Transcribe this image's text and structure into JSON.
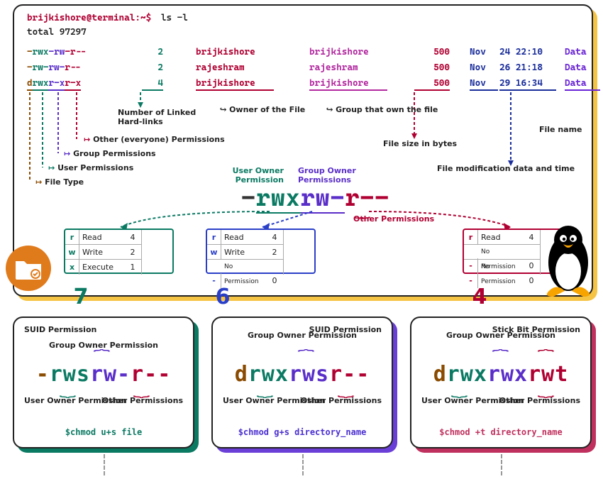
{
  "prompt": {
    "userhost": "brijkishore@terminal:~$",
    "cmd": "ls -l"
  },
  "total_line": "total 97297",
  "rows": [
    {
      "perm_d": "-",
      "perm_u": "rwx",
      "perm_g": "-rw",
      "perm_o": "-r--",
      "links": "2",
      "owner": "brijkishore",
      "group": "brijkishore",
      "size": "500",
      "month": "Nov",
      "daytime": "24 22:10",
      "name": "Data"
    },
    {
      "perm_d": "-",
      "perm_u": "rw-",
      "perm_g": "rw-",
      "perm_o": "r--",
      "links": "2",
      "owner": "rajeshram",
      "group": "rajeshram",
      "size": "500",
      "month": "Nov",
      "daytime": "26 21:18",
      "name": "Data"
    },
    {
      "perm_d": "d",
      "perm_u": "rwx",
      "perm_g": "r-x",
      "perm_o": "r-x",
      "links": "4",
      "owner": "brijkishore",
      "group": "brijkishore",
      "size": "500",
      "month": "Nov",
      "daytime": "29 16:34",
      "name": "Data"
    }
  ],
  "labels": {
    "hardlinks": "Number of Linked Hard-links",
    "owner": "Owner of the File",
    "group": "Group that own the file",
    "size": "File size in bytes",
    "mtime": "File modification data and time",
    "fname": "File name",
    "other_perm": "Other (everyone) Permissions",
    "group_perm": "Group Permissions",
    "user_perm": "User Permissions",
    "file_type": "File Type",
    "uo_perm": "User Owner Permission",
    "go_perm": "Group Owner Permissions",
    "oth_perm": "Other Permissions"
  },
  "bigperm": {
    "d": "-",
    "u": "rwx",
    "g": "rw-",
    "o": "r--"
  },
  "octal": {
    "green": {
      "rows": [
        {
          "s": "r",
          "n": "Read",
          "v": "4"
        },
        {
          "s": "w",
          "n": "Write",
          "v": "2"
        },
        {
          "s": "x",
          "n": "Execute",
          "v": "1"
        }
      ],
      "sum": "7"
    },
    "blue": {
      "rows": [
        {
          "s": "r",
          "n": "Read",
          "v": "4"
        },
        {
          "s": "w",
          "n": "Write",
          "v": "2"
        },
        {
          "s": "-",
          "n": "No Permission",
          "v": "0"
        }
      ],
      "sum": "6"
    },
    "red": {
      "rows": [
        {
          "s": "r",
          "n": "Read",
          "v": "4"
        },
        {
          "s": "-",
          "n": "No Permission",
          "v": "0"
        },
        {
          "s": "-",
          "n": "No Permission",
          "v": "0"
        }
      ],
      "sum": "4"
    }
  },
  "special": {
    "suid": {
      "title": "SUID Permission",
      "top_mid": "Group Owner Permission",
      "perm": {
        "d": "-",
        "u": "rws",
        "g": "rw-",
        "o": "r--"
      },
      "bot_l": "User Owner Permission",
      "bot_r": "Other Permissions",
      "cmd": "$chmod u+s file"
    },
    "sgid": {
      "top_mid": "Group Owner Permission",
      "top_r": "SUID Permission",
      "perm": {
        "d": "d",
        "u": "rwx",
        "g": "rws",
        "o": "r--"
      },
      "bot_l": "User Owner Permission",
      "bot_r": "Other Permissions",
      "cmd": "$chmod g+s directory_name"
    },
    "sticky": {
      "top_mid": "Group Owner Permission",
      "top_r": "Stick Bit Permission",
      "perm": {
        "d": "d",
        "u": "rwx",
        "g": "rwx",
        "o": "rwt"
      },
      "bot_l": "User Owner Permission",
      "bot_r": "Other Permissions",
      "cmd": "$chmod +t directory_name"
    }
  }
}
